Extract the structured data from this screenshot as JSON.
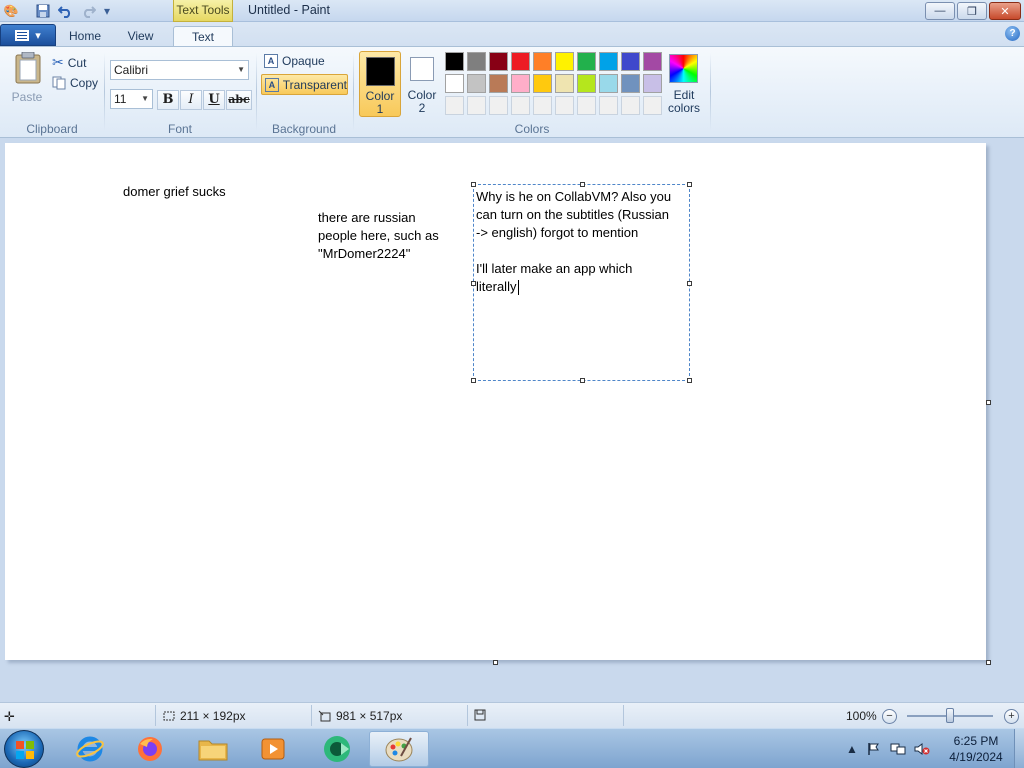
{
  "window": {
    "title": "Untitled - Paint",
    "context_tab": "Text Tools",
    "controls": {
      "minimize": "—",
      "maximize": "❐",
      "close": "✕"
    }
  },
  "tabs": [
    {
      "label": "Home",
      "active": false
    },
    {
      "label": "View",
      "active": false
    },
    {
      "label": "Text",
      "active": true
    }
  ],
  "ribbon": {
    "clipboard": {
      "paste": "Paste",
      "cut": "Cut",
      "copy": "Copy",
      "group_label": "Clipboard"
    },
    "font": {
      "family": "Calibri",
      "size": "11",
      "bold": "B",
      "italic": "I",
      "underline": "U",
      "strikethrough": "abc",
      "group_label": "Font"
    },
    "background": {
      "opaque": "Opaque",
      "transparent": "Transparent",
      "selected": "Transparent",
      "group_label": "Background"
    },
    "colors": {
      "color1_label": "Color\n1",
      "color2_label": "Color\n2",
      "color1": "#000000",
      "color2": "#ffffff",
      "edit_colors": "Edit\ncolors",
      "group_label": "Colors",
      "palette_row1": [
        "#000000",
        "#7f7f7f",
        "#880015",
        "#ed1c24",
        "#ff7f27",
        "#fff200",
        "#22b14c",
        "#00a2e8",
        "#3f48cc",
        "#a349a4"
      ],
      "palette_row2": [
        "#ffffff",
        "#c3c3c3",
        "#b97a57",
        "#ffaec9",
        "#ffc90e",
        "#efe4b0",
        "#b5e61d",
        "#99d9ea",
        "#7092be",
        "#c8bfe7"
      ],
      "palette_row3": [
        "#f0f0f0",
        "#f0f0f0",
        "#f0f0f0",
        "#f0f0f0",
        "#f0f0f0",
        "#f0f0f0",
        "#f0f0f0",
        "#f0f0f0",
        "#f0f0f0",
        "#f0f0f0"
      ]
    }
  },
  "canvas": {
    "text1": "domer grief sucks",
    "text2": "there are russian\npeople here, such as\n\"MrDomer2224\"",
    "textbox": "Why is he on CollabVM? Also you\ncan turn on the subtitles (Russian\n-> english) forgot to mention\n\nI'll later make an app which\nliterally"
  },
  "statusbar": {
    "selection_size": "211 × 192px",
    "canvas_size": "981 × 517px",
    "zoom": "100%"
  },
  "taskbar": {
    "apps": [
      "internet-explorer",
      "firefox",
      "file-explorer",
      "media-player",
      "collabvm",
      "paint"
    ],
    "time": "6:25 PM",
    "date": "4/19/2024"
  }
}
